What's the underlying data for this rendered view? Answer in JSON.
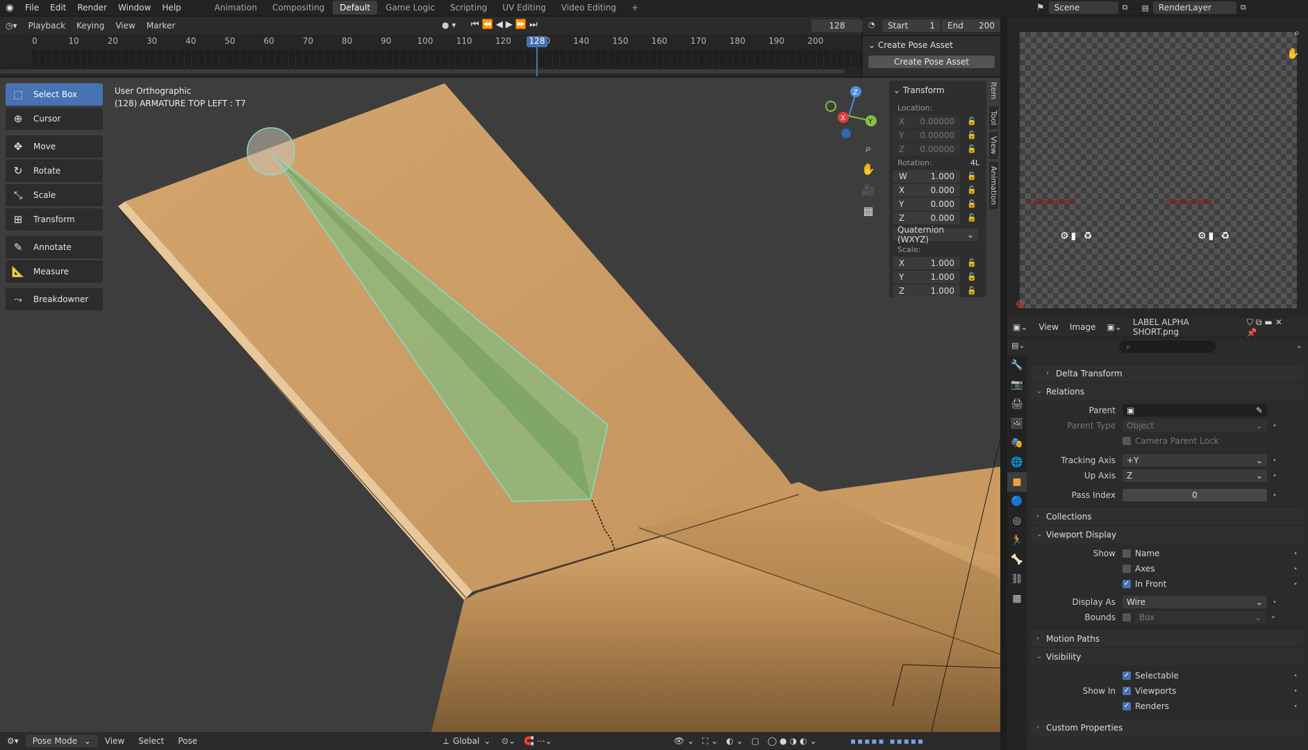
{
  "topbar": {
    "menus": [
      "File",
      "Edit",
      "Render",
      "Window",
      "Help"
    ],
    "workspaces": [
      "Animation",
      "Compositing",
      "Default",
      "Game Logic",
      "Scripting",
      "UV Editing",
      "Video Editing"
    ],
    "active_workspace": "Default",
    "add_workspace": "+",
    "scene": "Scene",
    "render_layer": "RenderLayer"
  },
  "timeline": {
    "menus": [
      "Playback",
      "Keying",
      "View",
      "Marker"
    ],
    "current_frame": "128",
    "start_label": "Start",
    "start": "1",
    "end_label": "End",
    "end": "200",
    "ticks": [
      "0",
      "10",
      "20",
      "30",
      "40",
      "50",
      "60",
      "70",
      "80",
      "90",
      "100",
      "110",
      "120",
      "130",
      "140",
      "150",
      "160",
      "170",
      "180",
      "190",
      "200"
    ],
    "playhead": "128"
  },
  "pose_asset": {
    "title": "Create Pose Asset",
    "button": "Create Pose Asset"
  },
  "viewport": {
    "view_name": "User Orthographic",
    "object_info": "(128) ARMATURE TOP LEFT : T7",
    "tools": [
      "Select Box",
      "Cursor",
      "Move",
      "Rotate",
      "Scale",
      "Transform",
      "Annotate",
      "Measure",
      "Breakdowner"
    ],
    "gizmo_axes": [
      "Z",
      "X",
      "Y"
    ],
    "mode": "Pose Mode",
    "header_menus": [
      "View",
      "Select",
      "Pose"
    ],
    "orientation": "Global",
    "side_tabs": [
      "Item",
      "Tool",
      "View",
      "Animation"
    ]
  },
  "transform_panel": {
    "title": "Transform",
    "location_label": "Location:",
    "location": [
      {
        "axis": "X",
        "value": "0.00000"
      },
      {
        "axis": "Y",
        "value": "0.00000"
      },
      {
        "axis": "Z",
        "value": "0.00000"
      }
    ],
    "rotation_label": "Rotation:",
    "rotation_mode_badge": "4L",
    "rotation": [
      {
        "axis": "W",
        "value": "1.000"
      },
      {
        "axis": "X",
        "value": "0.000"
      },
      {
        "axis": "Y",
        "value": "0.000"
      },
      {
        "axis": "Z",
        "value": "0.000"
      }
    ],
    "rotation_mode": "Quaternion (WXYZ)",
    "scale_label": "Scale:",
    "scale": [
      {
        "axis": "X",
        "value": "1.000"
      },
      {
        "axis": "Y",
        "value": "1.000"
      },
      {
        "axis": "Z",
        "value": "1.000"
      }
    ]
  },
  "image_editor": {
    "menus": [
      "View",
      "Image"
    ],
    "image_name": "LABEL ALPHA SHORT.png",
    "label_text": "Contient BOX"
  },
  "properties": {
    "sections": {
      "delta_transform": "Delta Transform",
      "relations": "Relations",
      "collections": "Collections",
      "viewport_display": "Viewport Display",
      "motion_paths": "Motion Paths",
      "visibility": "Visibility",
      "custom_properties": "Custom Properties"
    },
    "relations": {
      "parent_label": "Parent",
      "parent_type_label": "Parent Type",
      "parent_type": "Object",
      "camera_parent_lock": "Camera Parent Lock",
      "tracking_axis_label": "Tracking Axis",
      "tracking_axis": "+Y",
      "up_axis_label": "Up Axis",
      "up_axis": "Z",
      "pass_index_label": "Pass Index",
      "pass_index": "0"
    },
    "viewport_display": {
      "show_label": "Show",
      "name": "Name",
      "axes": "Axes",
      "in_front": "In Front",
      "display_as_label": "Display As",
      "display_as": "Wire",
      "bounds_label": "Bounds",
      "bounds": "Box"
    },
    "visibility": {
      "selectable": "Selectable",
      "show_in_label": "Show In",
      "viewports": "Viewports",
      "renders": "Renders"
    }
  },
  "colors": {
    "accent": "#4772b3",
    "mesh": "#c79a63",
    "bone": "#8fb77a",
    "bone_outline": "#7fe0c8",
    "object_tab": "#f0a040"
  }
}
